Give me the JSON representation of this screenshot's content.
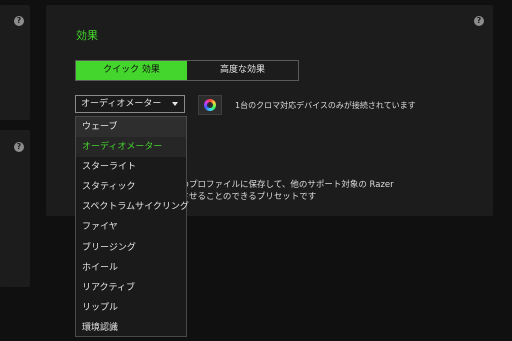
{
  "effects_panel": {
    "title": "効果",
    "tabs": [
      {
        "label": "クイック 効果",
        "active": true
      },
      {
        "label": "高度な効果",
        "active": false
      }
    ],
    "effect_select": {
      "value": "オーディオメーター"
    },
    "device_note": "1台のクロマ対応デバイスのみが接続されています",
    "description_line1": "スのプロファイルに保存して、他のサポート対象の Razer",
    "description_line2": "期させることのできるプリセットです"
  },
  "help_icon_glyph": "?",
  "dropdown": {
    "options": [
      {
        "label": "ウェーブ",
        "state": "hover"
      },
      {
        "label": "オーディオメーター",
        "state": "selected"
      },
      {
        "label": "スターライト",
        "state": ""
      },
      {
        "label": "スタティック",
        "state": ""
      },
      {
        "label": "スペクトラムサイクリング",
        "state": ""
      },
      {
        "label": "ファイヤ",
        "state": ""
      },
      {
        "label": "ブリージング",
        "state": ""
      },
      {
        "label": "ホイール",
        "state": ""
      },
      {
        "label": "リアクティブ",
        "state": ""
      },
      {
        "label": "リップル",
        "state": ""
      },
      {
        "label": "環境認識",
        "state": ""
      }
    ]
  },
  "colors": {
    "accent": "#44d62c",
    "background": "#101010",
    "panel": "#1c1c1c"
  }
}
